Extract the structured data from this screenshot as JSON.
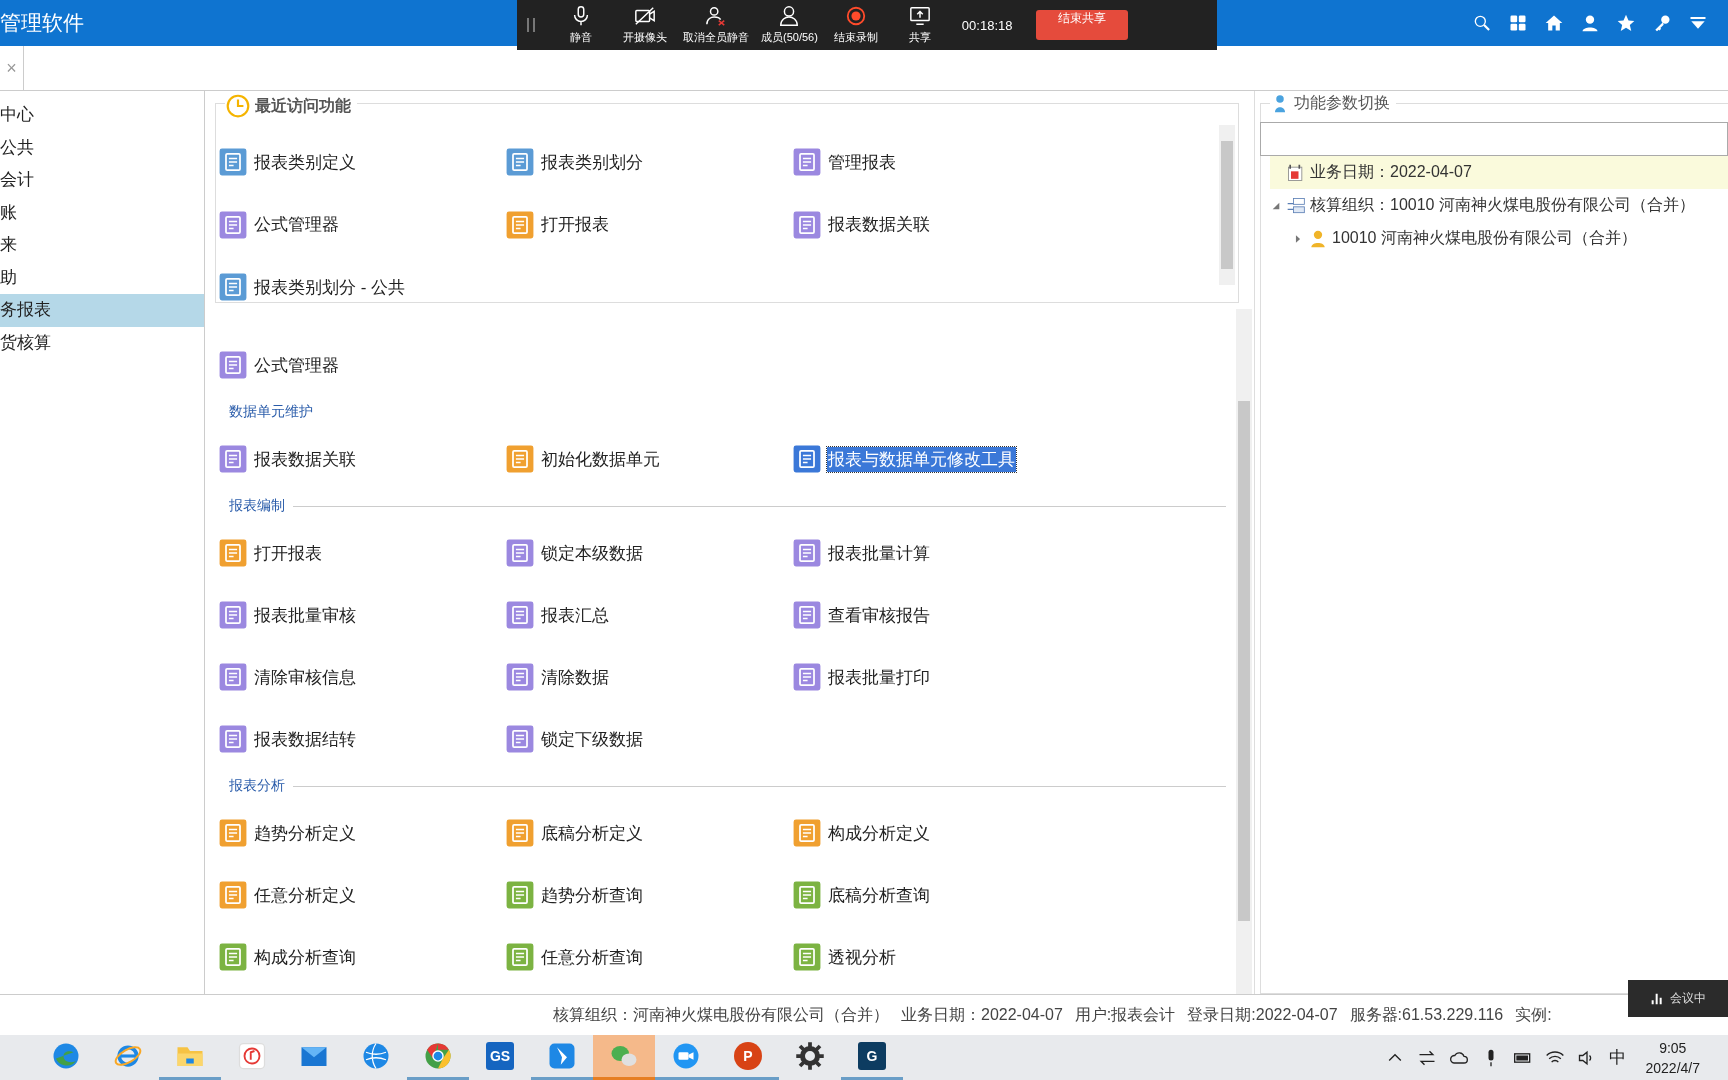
{
  "app": {
    "title": "管理软件"
  },
  "meeting": {
    "controls": [
      {
        "kind": "mic",
        "label": "静音"
      },
      {
        "kind": "camera",
        "label": "开摄像头"
      },
      {
        "kind": "unmute-all",
        "label": "取消全员静音"
      },
      {
        "kind": "members",
        "label": "成员(50/56)"
      },
      {
        "kind": "record",
        "label": "结束录制"
      },
      {
        "kind": "share",
        "label": "共享"
      }
    ],
    "timer": "00:18:18",
    "end_button": "结束共享"
  },
  "tab": {
    "close": "×"
  },
  "sidebar": {
    "items": [
      {
        "label": "中心",
        "selected": false
      },
      {
        "label": "公共",
        "selected": false
      },
      {
        "label": "会计",
        "selected": false
      },
      {
        "label": "账",
        "selected": false
      },
      {
        "label": "来",
        "selected": false
      },
      {
        "label": "助",
        "selected": false
      },
      {
        "label": "务报表",
        "selected": true
      },
      {
        "label": "货核算",
        "selected": false
      }
    ]
  },
  "recent": {
    "title": "最近访问功能",
    "items": [
      {
        "label": "报表类别定义",
        "color": "#5b9bd5"
      },
      {
        "label": "报表类别划分",
        "color": "#5b9bd5"
      },
      {
        "label": "管理报表",
        "color": "#9b88e0"
      },
      {
        "label": "公式管理器",
        "color": "#9b88e0"
      },
      {
        "label": "打开报表",
        "color": "#f0a030"
      },
      {
        "label": "报表数据关联",
        "color": "#9b88e0"
      },
      {
        "label": "报表类别划分 - 公共",
        "color": "#5b9bd5"
      }
    ]
  },
  "functions": {
    "sections": [
      {
        "items": [
          {
            "label": "公式管理器",
            "color": "#9b88e0",
            "selected": false
          }
        ]
      },
      {
        "title": "数据单元维护",
        "items": [
          {
            "label": "报表数据关联",
            "color": "#9b88e0",
            "selected": false
          },
          {
            "label": "初始化数据单元",
            "color": "#f0a030",
            "selected": false
          },
          {
            "label": "报表与数据单元修改工具",
            "color": "#3b78d8",
            "selected": true
          }
        ]
      },
      {
        "title": "报表编制",
        "items": [
          {
            "label": "打开报表",
            "color": "#f0a030",
            "selected": false
          },
          {
            "label": "锁定本级数据",
            "color": "#9b88e0",
            "selected": false
          },
          {
            "label": "报表批量计算",
            "color": "#9b88e0",
            "selected": false
          },
          {
            "label": "报表批量审核",
            "color": "#9b88e0",
            "selected": false
          },
          {
            "label": "报表汇总",
            "color": "#9b88e0",
            "selected": false
          },
          {
            "label": "查看审核报告",
            "color": "#9b88e0",
            "selected": false
          },
          {
            "label": "清除审核信息",
            "color": "#9b88e0",
            "selected": false
          },
          {
            "label": "清除数据",
            "color": "#9b88e0",
            "selected": false
          },
          {
            "label": "报表批量打印",
            "color": "#9b88e0",
            "selected": false
          },
          {
            "label": "报表数据结转",
            "color": "#9b88e0",
            "selected": false
          },
          {
            "label": "锁定下级数据",
            "color": "#9b88e0",
            "selected": false
          }
        ]
      },
      {
        "title": "报表分析",
        "items": [
          {
            "label": "趋势分析定义",
            "color": "#f0a030",
            "selected": false
          },
          {
            "label": "底稿分析定义",
            "color": "#f0a030",
            "selected": false
          },
          {
            "label": "构成分析定义",
            "color": "#f0a030",
            "selected": false
          },
          {
            "label": "任意分析定义",
            "color": "#f0a030",
            "selected": false
          },
          {
            "label": "趋势分析查询",
            "color": "#7cb342",
            "selected": false
          },
          {
            "label": "底稿分析查询",
            "color": "#7cb342",
            "selected": false
          },
          {
            "label": "构成分析查询",
            "color": "#7cb342",
            "selected": false
          },
          {
            "label": "任意分析查询",
            "color": "#7cb342",
            "selected": false
          },
          {
            "label": "透视分析",
            "color": "#7cb342",
            "selected": false
          }
        ]
      }
    ]
  },
  "param_panel": {
    "title": "功能参数切换",
    "tree": [
      {
        "kind": "date",
        "label": "业务日期：2022-04-07",
        "selected": true
      },
      {
        "kind": "org",
        "label": "核算组织：10010 河南神火煤电股份有限公司（合并）",
        "selected": false,
        "expanded": true,
        "children": [
          {
            "kind": "company",
            "label": "10010 河南神火煤电股份有限公司（合并）",
            "selected": false,
            "expanded": false
          }
        ]
      }
    ]
  },
  "status_bar": [
    "核算组织：河南神火煤电股份有限公司（合并）",
    "业务日期：2022-04-07",
    "用户:报表会计",
    "登录日期:2022-04-07",
    "服务器:61.53.229.116",
    "实例:"
  ],
  "meeting_badge": "会议中",
  "taskbar": {
    "apps": [
      {
        "kind": "edge",
        "running": false,
        "selected": false
      },
      {
        "kind": "ie",
        "running": false,
        "selected": false
      },
      {
        "kind": "folder",
        "running": true,
        "selected": false
      },
      {
        "kind": "music",
        "running": false,
        "selected": false
      },
      {
        "kind": "mail",
        "running": false,
        "selected": false
      },
      {
        "kind": "globe",
        "running": false,
        "selected": false
      },
      {
        "kind": "chrome",
        "running": true,
        "selected": false
      },
      {
        "kind": "tile",
        "label": "GS",
        "color": "#1565c0",
        "running": false,
        "selected": false
      },
      {
        "kind": "arrow",
        "running": true,
        "selected": false
      },
      {
        "kind": "chat",
        "running": true,
        "selected": true
      },
      {
        "kind": "camera",
        "running": true,
        "selected": false
      },
      {
        "kind": "round",
        "label": "P",
        "color": "#d84315",
        "running": true,
        "selected": false
      },
      {
        "kind": "gear",
        "running": false,
        "selected": false
      },
      {
        "kind": "tile",
        "label": "G",
        "color": "#0d3c61",
        "running": true,
        "selected": false
      }
    ],
    "ime": "中",
    "time": "9:05",
    "date": "2022/4/7"
  }
}
